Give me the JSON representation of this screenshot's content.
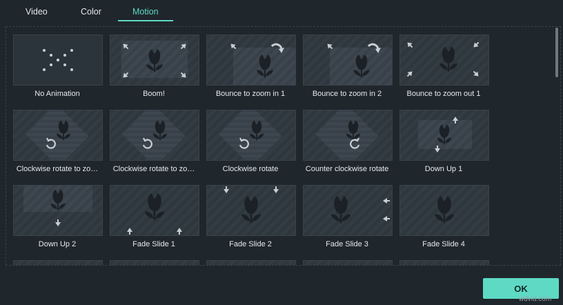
{
  "tabs": [
    {
      "label": "Video",
      "active": false
    },
    {
      "label": "Color",
      "active": false
    },
    {
      "label": "Motion",
      "active": true
    }
  ],
  "accent_color": "#5ed9c4",
  "motions": [
    {
      "label": "No Animation",
      "icon": "dots-x-icon"
    },
    {
      "label": "Boom!",
      "icon": "tulip-expand-icon"
    },
    {
      "label": "Bounce to zoom in 1",
      "icon": "tulip-bounce-zoom-icon"
    },
    {
      "label": "Bounce to zoom in 2",
      "icon": "tulip-bounce-zoom-icon"
    },
    {
      "label": "Bounce to zoom out 1",
      "icon": "tulip-zoom-out-icon"
    },
    {
      "label": "Clockwise rotate to zo…",
      "icon": "rotate-cw-icon"
    },
    {
      "label": "Clockwise rotate to zo…",
      "icon": "rotate-cw-icon"
    },
    {
      "label": "Clockwise rotate",
      "icon": "rotate-cw-icon"
    },
    {
      "label": "Counter clockwise rotate",
      "icon": "rotate-ccw-icon"
    },
    {
      "label": "Down Up 1",
      "icon": "arrows-up-down-icon"
    },
    {
      "label": "Down Up 2",
      "icon": "arrow-down-icon"
    },
    {
      "label": "Fade Slide 1",
      "icon": "arrows-up-icon"
    },
    {
      "label": "Fade Slide 2",
      "icon": "arrows-down-icon"
    },
    {
      "label": "Fade Slide 3",
      "icon": "arrows-left-icon"
    },
    {
      "label": "Fade Slide 4",
      "icon": "arrows-right-icon"
    }
  ],
  "ok_label": "OK",
  "watermark": "wdvid.com"
}
